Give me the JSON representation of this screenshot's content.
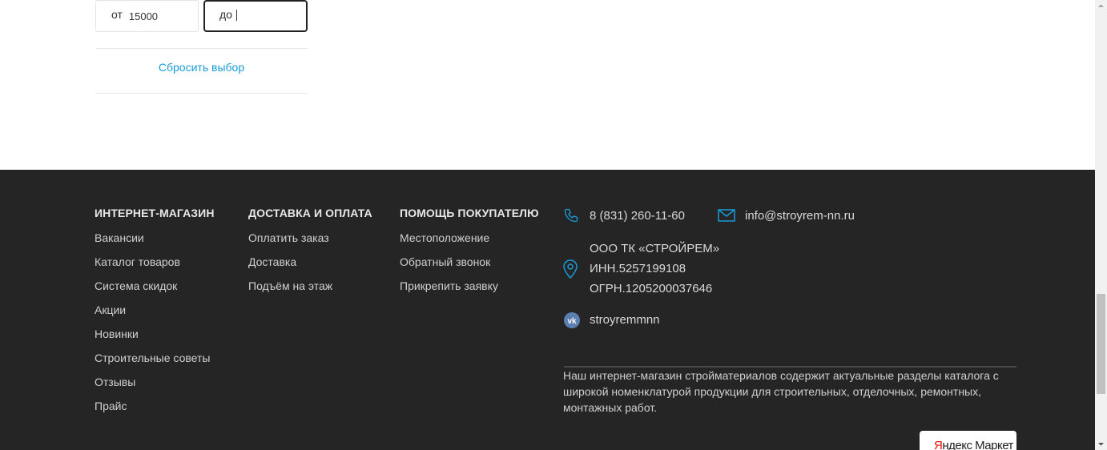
{
  "filter": {
    "from_prefix": "от",
    "from_value": "15000",
    "to_prefix": "до",
    "reset_label": "Сбросить выбор"
  },
  "footer": {
    "columns": [
      {
        "title": "ИНТЕРНЕТ-МАГАЗИН",
        "links": [
          "Вакансии",
          "Каталог товаров",
          "Система скидок",
          "Акции",
          "Новинки",
          "Строительные советы",
          "Отзывы",
          "Прайс"
        ]
      },
      {
        "title": "ДОСТАВКА И ОПЛАТА",
        "links": [
          "Оплатить заказ",
          "Доставка",
          "Подъём на этаж"
        ]
      },
      {
        "title": "ПОМОЩЬ ПОКУПАТЕЛЮ",
        "links": [
          "Местоположение",
          "Обратный звонок",
          "Прикрепить заявку"
        ]
      }
    ],
    "phone": "8 (831) 260-11-60",
    "email": "info@stroyrem-nn.ru",
    "company": {
      "name": "ООО ТК «СТРОЙРЕМ»",
      "inn": "ИНН.5257199108",
      "ogrn": "ОГРН.1205200037646"
    },
    "vk": "stroyremmnn",
    "about": "Наш интернет-магазин стройматериалов содержит актуальные разделы каталога с широкой номенклатурой продукции для строительных, отделочных, ремонтных, монтажных работ.",
    "ym_badge": {
      "y": "Я",
      "rest": "ндекс Маркет"
    },
    "icons": {
      "phone": "phone-icon",
      "email": "mail-icon",
      "location": "location-pin-icon",
      "vk": "vk-icon"
    },
    "colors": {
      "background": "#252525",
      "accent": "#1a9bd7",
      "link": "#1a9bd7"
    }
  }
}
